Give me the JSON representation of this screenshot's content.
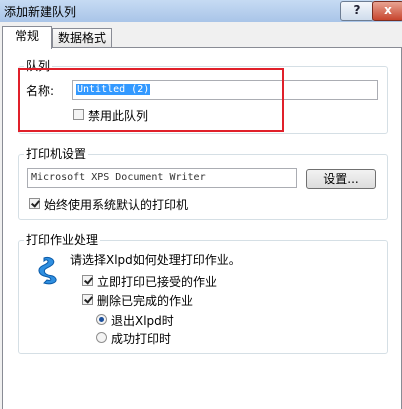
{
  "window": {
    "title": "添加新建队列",
    "help_label": "?",
    "close_label": "x"
  },
  "tabs": [
    {
      "label": "常规"
    },
    {
      "label": "数据格式"
    }
  ],
  "queue": {
    "legend": "队列",
    "name_label": "名称:",
    "name_value": "Untitled (2)",
    "disable_label": "禁用此队列",
    "disable_checked": false
  },
  "printer": {
    "legend": "打印机设置",
    "printer_name": "Microsoft XPS Document Writer",
    "settings_button": "设置...",
    "use_default_label": "始终使用系统默认的打印机",
    "use_default_checked": true
  },
  "job": {
    "legend": "打印作业处理",
    "instruction": "请选择Xlpd如何处理打印作业。",
    "icon": "paper-print-icon",
    "print_immediately_label": "立即打印已接受的作业",
    "print_immediately_checked": true,
    "delete_done_label": "删除已完成的作业",
    "delete_done_checked": true,
    "radio_exit_label": "退出Xlpd时",
    "radio_success_label": "成功打印时",
    "radio_selected": "exit"
  },
  "colors": {
    "highlight": "#e0202a",
    "selection": "#3399ff"
  }
}
